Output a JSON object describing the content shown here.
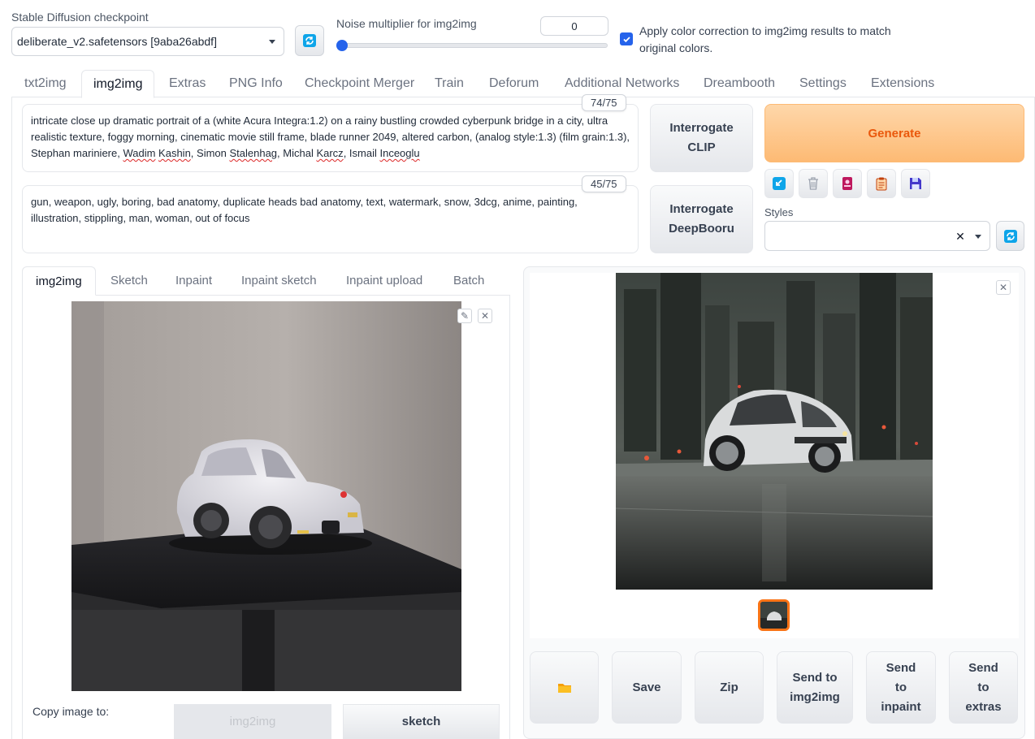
{
  "checkpoint": {
    "label": "Stable Diffusion checkpoint",
    "value": "deliberate_v2.safetensors [9aba26abdf]"
  },
  "noise": {
    "label": "Noise multiplier for img2img",
    "value": "0",
    "slider_fraction": 0
  },
  "color_correction": {
    "checked": true,
    "label": "Apply color correction to img2img results to match original colors."
  },
  "main_tabs": [
    "txt2img",
    "img2img",
    "Extras",
    "PNG Info",
    "Checkpoint Merger",
    "Train",
    "Deforum",
    "Additional Networks",
    "Dreambooth",
    "Settings",
    "Extensions"
  ],
  "active_main_tab": "img2img",
  "prompt": {
    "counter": "74/75",
    "part1": "intricate close up dramatic portrait of a (white Acura Integra:1.2) on a rainy bustling crowded cyberpunk bridge in a city, ultra realistic texture, foggy morning, cinematic movie still frame, blade runner 2049, altered carbon, (analog style:1.3) (film grain:1.3), Stephan mariniere, ",
    "w1": "Wadim",
    "s1": " ",
    "w2": "Kashin",
    "part2": ", Simon ",
    "w3": "Stalenhag",
    "part3": ", Michal ",
    "w4": "Karcz",
    "part4": ", Ismail ",
    "w5": "Inceoglu"
  },
  "negative_prompt": {
    "counter": "45/75",
    "text": " gun, weapon, ugly, boring, bad anatomy, duplicate heads bad anatomy, text, watermark, snow, 3dcg, anime, painting, illustration, stippling, man, woman, out of focus"
  },
  "buttons": {
    "interrogate_clip": "Interrogate CLIP",
    "interrogate_deepbooru": "Interrogate DeepBooru",
    "generate": "Generate",
    "styles_label": "Styles",
    "copy_image_to": "Copy image to:",
    "copy_img2img": "img2img",
    "copy_sketch": "sketch"
  },
  "tool_icons": [
    "arrow-icon",
    "trash-icon",
    "card-icon",
    "clipboard-icon",
    "save-icon"
  ],
  "image_tabs": [
    "img2img",
    "Sketch",
    "Inpaint",
    "Inpaint sketch",
    "Inpaint upload",
    "Batch"
  ],
  "active_image_tab": "img2img",
  "output_actions": [
    "Save",
    "Zip",
    "Send to img2img",
    "Send to inpaint",
    "Send to extras"
  ],
  "colors": {
    "accent": "#f97316",
    "link_blue": "#0ea5e9",
    "checkbox": "#2563eb"
  }
}
